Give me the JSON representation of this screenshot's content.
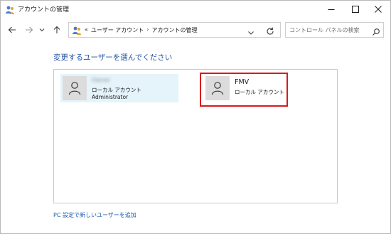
{
  "window": {
    "title": "アカウントの管理"
  },
  "address": {
    "overflow": "«",
    "crumbs": [
      "ユーザー アカウント",
      "アカウントの管理"
    ],
    "separator": "›"
  },
  "search": {
    "placeholder": "コントロール パネルの検索"
  },
  "main": {
    "heading": "変更するユーザーを選んでください",
    "accounts": [
      {
        "name": "Owner",
        "name_obscured": true,
        "type": "ローカル アカウント",
        "role": "Administrator",
        "selected": true
      },
      {
        "name": "FMV",
        "type": "ローカル アカウント",
        "highlighted": true
      }
    ],
    "add_user_link": "PC 設定で新しいユーザーを追加"
  },
  "icons": {
    "app": "users-icon",
    "back": "back-arrow-icon",
    "forward": "forward-arrow-icon",
    "recent": "chevron-down-icon",
    "up": "up-arrow-icon",
    "address": "users-icon",
    "dropdown": "chevron-down-icon",
    "refresh": "refresh-icon",
    "search": "search-icon",
    "avatar": "user-icon"
  },
  "colors": {
    "heading": "#1f4fa0",
    "link": "#1a5cb4",
    "selected_tile": "#e5f3fb",
    "highlight_box": "#d71b1b",
    "avatar_bg": "#dcdcdc"
  }
}
